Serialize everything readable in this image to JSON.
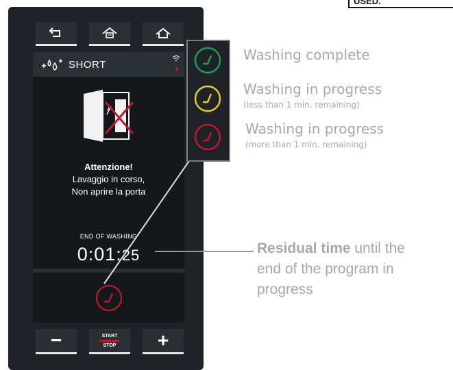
{
  "corner_tag": "USED.",
  "screen": {
    "program_name": "SHORT",
    "warning": {
      "title": "Attenzione!",
      "line1": "Lavaggio in corso,",
      "line2": "Non aprire la porta"
    },
    "end_label": "END OF WASHING",
    "time_main": "0:01:",
    "time_seconds": "25"
  },
  "bottom_bar": {
    "minus": "−",
    "start": "START",
    "stop": "STOP",
    "plus": "+"
  },
  "legend": [
    {
      "color": "#1e9e57",
      "title": "Washing complete",
      "detail": ""
    },
    {
      "color": "#e7d21a",
      "title": "Washing in progress",
      "detail": "(less than 1 min. remaining)"
    },
    {
      "color": "#c2182b",
      "title": "Washing in progress",
      "detail": "(more than 1 min. remaining)"
    }
  ],
  "residual": {
    "bold": "Residual time",
    "rest1": " until the",
    "line2": "end of the program in",
    "line3": "progress"
  },
  "colors": {
    "accent_red": "#c2182b",
    "panel": "#1f2327"
  }
}
